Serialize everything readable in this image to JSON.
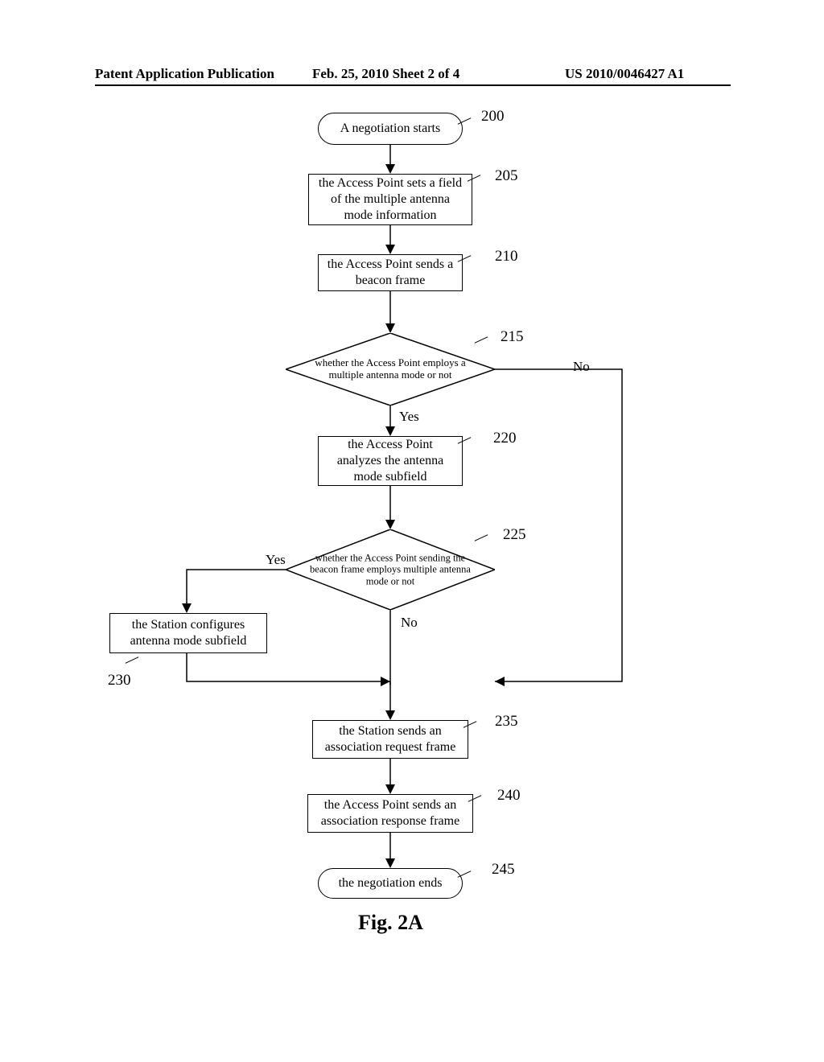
{
  "header": {
    "left": "Patent Application Publication",
    "center": "Feb. 25, 2010  Sheet 2 of 4",
    "right": "US 2010/0046427 A1"
  },
  "refs": {
    "r200": "200",
    "r205": "205",
    "r210": "210",
    "r215": "215",
    "r220": "220",
    "r225": "225",
    "r230": "230",
    "r235": "235",
    "r240": "240",
    "r245": "245"
  },
  "nodes": {
    "start": "A negotiation starts",
    "n205": "the Access Point sets a field of the multiple antenna mode information",
    "n210": "the Access Point sends a beacon frame",
    "d215": "whether the Access Point employs a multiple antenna mode or not",
    "n220": "the Access Point analyzes the antenna mode subfield",
    "d225": "whether the Access Point sending the beacon frame employs multiple antenna mode or not",
    "n230": "the Station configures antenna mode subfield",
    "n235": "the Station sends an association request frame",
    "n240": "the Access Point sends an association response frame",
    "end": "the negotiation ends"
  },
  "labels": {
    "yes": "Yes",
    "no": "No"
  },
  "caption": "Fig. 2A"
}
